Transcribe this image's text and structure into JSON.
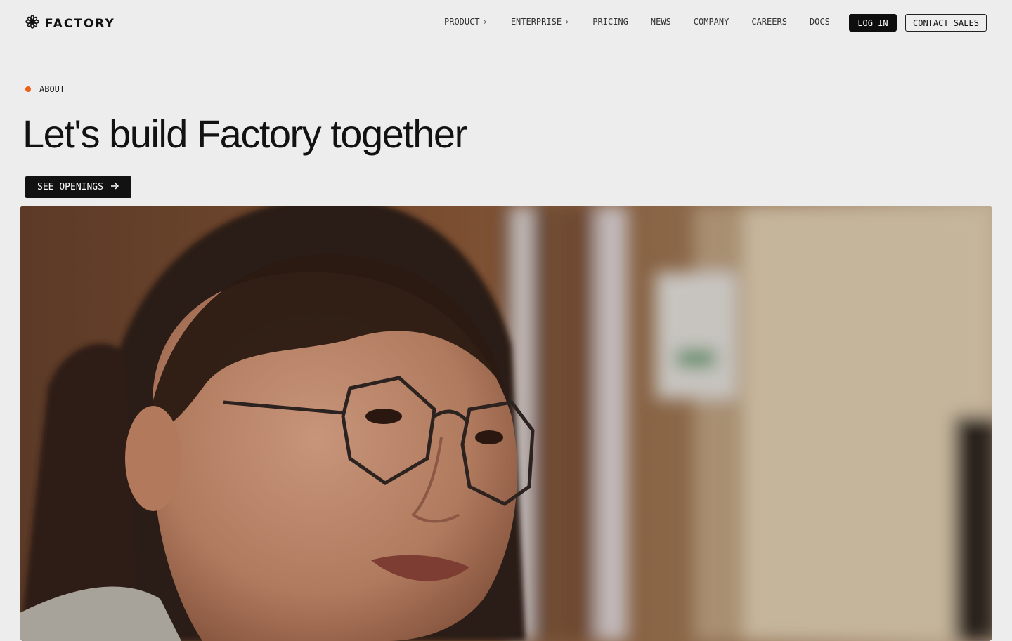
{
  "brand": {
    "name": "FACTORY",
    "logo_icon": "asterisk-flower-icon"
  },
  "nav": {
    "items": [
      {
        "label": "PRODUCT",
        "has_chevron": true
      },
      {
        "label": "ENTERPRISE",
        "has_chevron": true
      },
      {
        "label": "PRICING",
        "has_chevron": false
      },
      {
        "label": "NEWS",
        "has_chevron": false
      },
      {
        "label": "COMPANY",
        "has_chevron": false
      },
      {
        "label": "CAREERS",
        "has_chevron": false
      },
      {
        "label": "DOCS",
        "has_chevron": false
      }
    ],
    "login_label": "LOG IN",
    "contact_label": "CONTACT SALES"
  },
  "section": {
    "label": "ABOUT",
    "headline": "Let's build Factory together",
    "cta_label": "SEE OPENINGS",
    "cta_icon": "arrow-right-icon"
  },
  "colors": {
    "background": "#ededed",
    "accent_dot": "#ee6018",
    "button_dark": "#121212"
  }
}
